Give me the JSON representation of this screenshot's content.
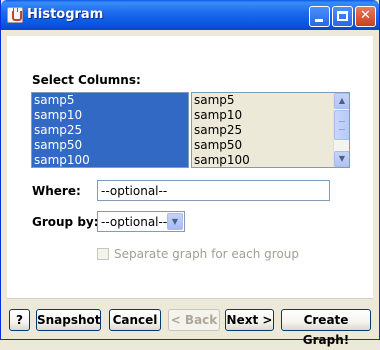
{
  "window": {
    "title": "Histogram",
    "controls": {
      "minimize": "",
      "maximize": "",
      "close": "✕"
    }
  },
  "select_columns": {
    "label": "Select Columns:",
    "selected_list": [
      "samp5",
      "samp10",
      "samp25",
      "samp50",
      "samp100"
    ],
    "available_list": [
      "samp5",
      "samp10",
      "samp25",
      "samp50",
      "samp100"
    ],
    "scroll_up_glyph": "▲",
    "scroll_down_glyph": "▼"
  },
  "where": {
    "label": "Where:",
    "value": "--optional--"
  },
  "group_by": {
    "label": "Group by:",
    "value": "--optional--",
    "arrow_glyph": "▼"
  },
  "separate_graph": {
    "label": "Separate graph for each group",
    "checked": false,
    "enabled": false
  },
  "buttons": {
    "help": "?",
    "snapshot": "Snapshot",
    "cancel": "Cancel",
    "back": "< Back",
    "next": "Next >",
    "create": "Create Graph!"
  },
  "colors": {
    "titlebar": "#0a56e0",
    "selection": "#3269c5",
    "dialog_bg": "#ece9d8"
  }
}
